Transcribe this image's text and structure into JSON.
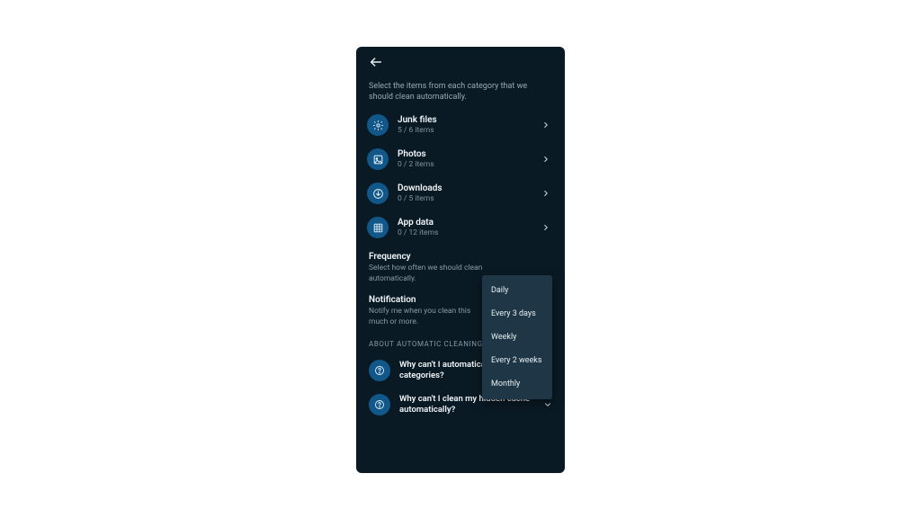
{
  "header": {
    "back_icon": "arrow-left"
  },
  "intro": "Select the items from each category that we should clean automatically.",
  "categories": [
    {
      "icon": "gear",
      "title": "Junk files",
      "sub": "5 / 6 items"
    },
    {
      "icon": "image",
      "title": "Photos",
      "sub": "0 / 2 items"
    },
    {
      "icon": "download",
      "title": "Downloads",
      "sub": "0 / 5 items"
    },
    {
      "icon": "grid",
      "title": "App data",
      "sub": "0 / 12 items"
    }
  ],
  "frequency": {
    "title": "Frequency",
    "sub": "Select how often we should clean automatically.",
    "options": [
      "Daily",
      "Every 3 days",
      "Weekly",
      "Every 2 weeks",
      "Monthly"
    ]
  },
  "notification": {
    "title": "Notification",
    "sub": "Notify me when you clean this much or more."
  },
  "about_label": "ABOUT AUTOMATIC CLEANING",
  "faq": [
    {
      "q": "Why can't I automatically clean some categories?"
    },
    {
      "q": "Why can't I clean my hidden cache automatically?"
    }
  ]
}
